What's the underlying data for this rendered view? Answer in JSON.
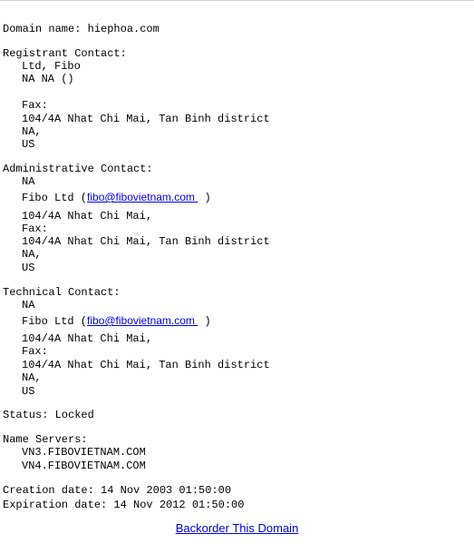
{
  "domain_label": "Domain name: hiephoa.com",
  "registrant": {
    "heading": "Registrant Contact:",
    "name": "Ltd, Fibo",
    "phone": "NA NA ()",
    "fax": "Fax:",
    "address": "104/4A Nhat Chi Mai, Tan Binh district",
    "state": "NA,",
    "country": "US"
  },
  "admin": {
    "heading": "Administrative Contact:",
    "line1": "NA",
    "org": "Fibo Ltd (",
    "email": "fibo@fibovietnam.com ",
    "close": ")",
    "street": "104/4A Nhat Chi Mai,",
    "fax": "Fax:",
    "address": "104/4A Nhat Chi Mai, Tan Binh district",
    "state": "NA,",
    "country": "US"
  },
  "tech": {
    "heading": "Technical Contact:",
    "line1": "NA",
    "org": "Fibo Ltd (",
    "email": "fibo@fibovietnam.com ",
    "close": ")",
    "street": "104/4A Nhat Chi Mai,",
    "fax": "Fax:",
    "address": "104/4A Nhat Chi Mai, Tan Binh district",
    "state": "NA,",
    "country": "US"
  },
  "status": "Status: Locked",
  "name_servers": {
    "heading": "Name Servers:",
    "items": [
      "VN3.FIBOVIETNAM.COM",
      "VN4.FIBOVIETNAM.COM"
    ]
  },
  "creation": "Creation date: 14 Nov 2003 01:50:00",
  "expiration": "Expiration date: 14 Nov 2012 01:50:00",
  "backorder_link": "Backorder This Domain"
}
